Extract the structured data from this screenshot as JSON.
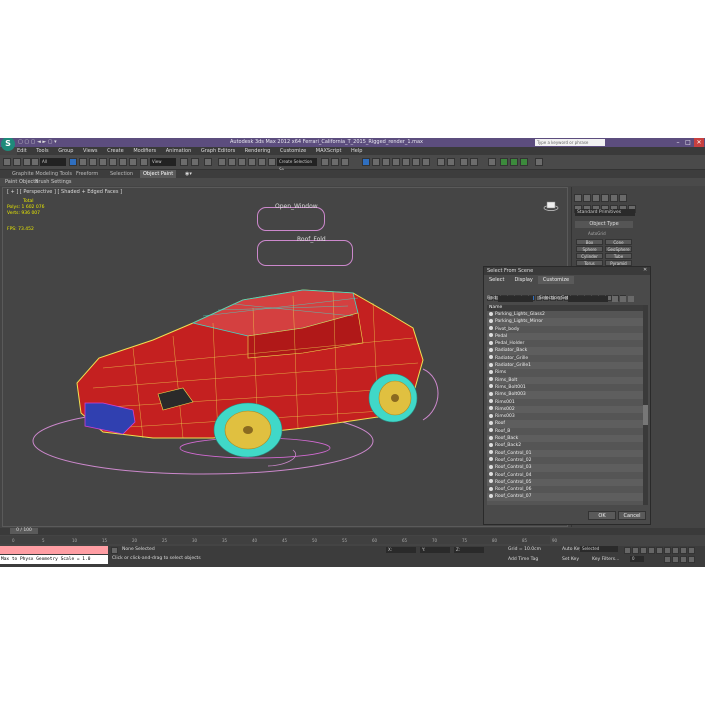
{
  "title_bar": {
    "logo": "S",
    "title": "Autodesk 3ds Max 2012 x64     Ferrari_California_T_2015_Rigged_render_1.max",
    "search_placeholder": "Type a keyword or phrase",
    "controls": [
      "–",
      "□",
      "✕"
    ]
  },
  "menu": [
    "Edit",
    "Tools",
    "Group",
    "Views",
    "Create",
    "Modifiers",
    "Animation",
    "Graph Editors",
    "Rendering",
    "Customize",
    "MAXScript",
    "Help"
  ],
  "toolbar": {
    "selection_filter": "All",
    "reference_coord": "View",
    "named_selection": "Create Selection Se"
  },
  "ribbon": {
    "tabs": [
      "Graphite Modeling Tools",
      "Freeform",
      "Selection",
      "Object Paint"
    ],
    "active_tab": "Object Paint",
    "sub_items": [
      "Paint Objects",
      "Brush Settings"
    ]
  },
  "viewport": {
    "label": "[ + ] [ Perspective ] [ Shaded + Edged Faces ]",
    "stats": {
      "total_label": "Total",
      "polys_label": "Polys:",
      "polys_value": "1 602 076",
      "verts_label": "Verts:",
      "verts_value": "936 007",
      "fps_label": "FPS:",
      "fps_value": "73.452"
    },
    "helpers": [
      "Open_Window",
      "Roof_Fold"
    ]
  },
  "command_panel": {
    "dropdown": "Standard Primitives",
    "rollout": "Object Type",
    "autogrid": "AutoGrid",
    "buttons": [
      "Box",
      "Cone",
      "Sphere",
      "GeoSphere",
      "Cylinder",
      "Tube",
      "Torus",
      "Pyramid"
    ]
  },
  "dialog": {
    "title": "Select From Scene",
    "menu": [
      "Select",
      "Display",
      "Customize"
    ],
    "find_label": "Find:",
    "selection_set_label": "Selection Set:",
    "column_header": "Name",
    "items": [
      "Parking_Lights_Glass2",
      "Parking_Lights_Mirror",
      "Pivot_body",
      "Pedal",
      "Pedal_Holder",
      "Radiator_Back",
      "Radiator_Grille",
      "Radiator_Grille1",
      "Rims",
      "Rims_Bolt",
      "Rims_Bolt001",
      "Rims_Bolt003",
      "Rims001",
      "Rims002",
      "Rims003",
      "Roof",
      "Roof_B",
      "Roof_Back",
      "Roof_Back2",
      "Roof_Control_01",
      "Roof_Control_02",
      "Roof_Control_03",
      "Roof_Control_04",
      "Roof_Control_05",
      "Roof_Control_06",
      "Roof_Control_07"
    ],
    "ok": "OK",
    "cancel": "Cancel"
  },
  "timeline": {
    "frame_counter": "0 / 100",
    "ticks": [
      "0",
      "5",
      "10",
      "15",
      "20",
      "25",
      "30",
      "35",
      "40",
      "45",
      "50",
      "55",
      "60",
      "65",
      "70",
      "75",
      "80",
      "85",
      "90"
    ]
  },
  "status": {
    "maxscript_output": "Max to Physx Geometry Scale = 1.0",
    "selection_status": "None Selected",
    "prompt": "Click or click-and-drag to select objects",
    "grid": "Grid = 10.0cm",
    "add_time_tag": "Add Time Tag",
    "auto_key": "Auto Key",
    "auto_key_value": "Selected",
    "set_key": "Set Key",
    "key_filters": "Key Filters..."
  },
  "colors": {
    "title_bar": "#5c4d7e",
    "car_body": "#c42020",
    "car_wire": "#f0e050",
    "tire_wire": "#40d8c8",
    "helper": "#cc88cc",
    "stats_text": "#e8e800"
  }
}
